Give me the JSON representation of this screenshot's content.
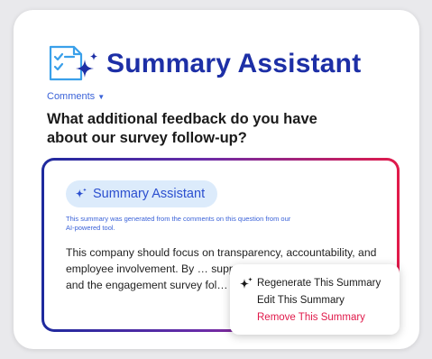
{
  "header": {
    "title": "Summary Assistant",
    "comments_label": "Comments",
    "question": "What additional feedback do you have about our survey follow-up?"
  },
  "summary": {
    "chip_label": "Summary Assistant",
    "note": "This summary was generated from the comments on this question from our AI-powered tool.",
    "text": "This company should focus on transparency, accountability, and employee involvement. By … support for managers and leade… and the engagement survey fol…"
  },
  "menu": {
    "regenerate": "Regenerate This Summary",
    "edit": "Edit This Summary",
    "remove": "Remove This Summary"
  },
  "colors": {
    "brand": "#1d2fa6",
    "link": "#3a62d8",
    "chip_bg": "#dcebfb",
    "danger": "#e0194a",
    "gradient_start": "#1e2a9e",
    "gradient_end": "#e11a4a"
  },
  "icons": {
    "logo": "checklist-sparkle-icon",
    "chip": "sparkle-icon",
    "menu": "sparkle-icon",
    "caret": "caret-down-icon"
  }
}
